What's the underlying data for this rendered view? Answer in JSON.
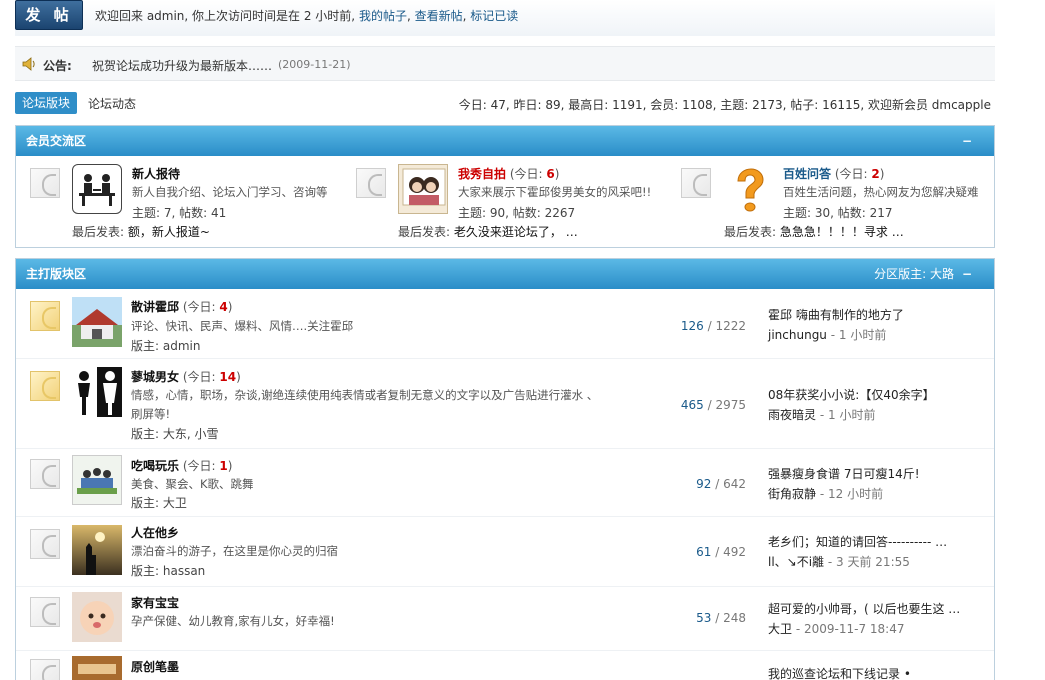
{
  "topbar": {
    "post_button": "发 帖",
    "welcome_prefix": "欢迎回来  admin, 你上次访问时间是在  2 小时前,",
    "link_my_posts": "我的帖子",
    "link_new_posts": "查看新帖",
    "link_mark_read": "标记已读",
    "sep": ","
  },
  "announcement": {
    "label": "公告:",
    "text": "祝贺论坛成功升级为最新版本……",
    "date": "(2009-11-21)"
  },
  "tabs": {
    "active": "论坛版块",
    "other": "论坛动态"
  },
  "stats": "今日: 47, 昨日: 89, 最高日: 1191, 会员: 1108, 主题: 2173, 帖子: 16115, 欢迎新会员  dmcapple",
  "section1": {
    "title": "会员交流区",
    "collapse": "−",
    "forums": [
      {
        "name": "新人报待",
        "today": "",
        "today_label": "",
        "today_count": "",
        "desc": "新人自我介绍、论坛入门学习、咨询等",
        "stats": "主题: 7, 帖数: 41",
        "last_label": "最后发表:",
        "last": "额，新人报道~"
      },
      {
        "name": "我秀自拍",
        "today_label": "(今日: ",
        "today_count": "6",
        "today_close": ")",
        "desc": "大家来展示下霍邱俊男美女的风采吧!!",
        "stats": "主题: 90, 帖数: 2267",
        "last_label": "最后发表:",
        "last": "老久没来逛论坛了，  …"
      },
      {
        "name": "百姓问答",
        "today_label": "(今日: ",
        "today_count": "2",
        "today_close": ")",
        "desc": "百姓生活问题，热心网友为您解决疑难",
        "stats": "主题: 30, 帖数: 217",
        "last_label": "最后发表:",
        "last": "急急急！！！！寻求  …"
      }
    ]
  },
  "section2": {
    "title": "主打版块区",
    "moderator_label": "分区版主:",
    "moderator": "大路",
    "collapse": "−",
    "forums": [
      {
        "name": "散讲霍邱",
        "today_label": "(今日: ",
        "today_count": "4",
        "today_close": ")",
        "desc": "评论、快讯、民声、爆料、风情….关注霍邱",
        "mods": "版主:  admin",
        "topics": "126",
        "posts": "/ 1222",
        "lp_title": "霍邱  嗨曲有制作的地方了",
        "lp_user": "jinchungu",
        "lp_time": "- 1 小时前"
      },
      {
        "name": "蓼城男女",
        "today_label": "(今日: ",
        "today_count": "14",
        "today_close": ")",
        "desc": "情感，心情，职场，杂谈,谢绝连续使用纯表情或者复制无意义的文字以及广告贴进行灌水  、刷屏等!",
        "mods": "版主:  大东, 小雪",
        "topics": "465",
        "posts": "/ 2975",
        "lp_title": "08年获奖小小说:【仅40余字】",
        "lp_user": "雨夜暗灵",
        "lp_time": "- 1 小时前"
      },
      {
        "name": "吃喝玩乐",
        "today_label": "(今日: ",
        "today_count": "1",
        "today_close": ")",
        "desc": "美食、聚会、K歌、跳舞",
        "mods": "版主:  大卫",
        "topics": "92",
        "posts": "/ 642",
        "lp_title": "强暴瘦身食谱  7日可瘦14斤!",
        "lp_user": "街角寂静",
        "lp_time": "- 12 小时前"
      },
      {
        "name": "人在他乡",
        "desc": "漂泊奋斗的游子，在这里是你心灵的归宿",
        "mods": "版主:  hassan",
        "topics": "61",
        "posts": "/ 492",
        "lp_title": "老乡们；知道的请回答---------- …",
        "lp_user": "ll、↘不i離",
        "lp_time": "- 3 天前 21:55"
      },
      {
        "name": "家有宝宝",
        "desc": "孕产保健、幼儿教育,家有儿女，好幸福!",
        "mods": "",
        "topics": "53",
        "posts": "/ 248",
        "lp_title": "超可爱的小帅哥，( 以后也要生这  …",
        "lp_user": "大卫",
        "lp_time": "- 2009-11-7 18:47"
      },
      {
        "name": "原创笔墨",
        "desc": "",
        "mods": "",
        "topics": "",
        "posts": "",
        "lp_title": "我的巡查论坛和下线记录 •",
        "lp_user": "",
        "lp_time": ""
      }
    ]
  }
}
